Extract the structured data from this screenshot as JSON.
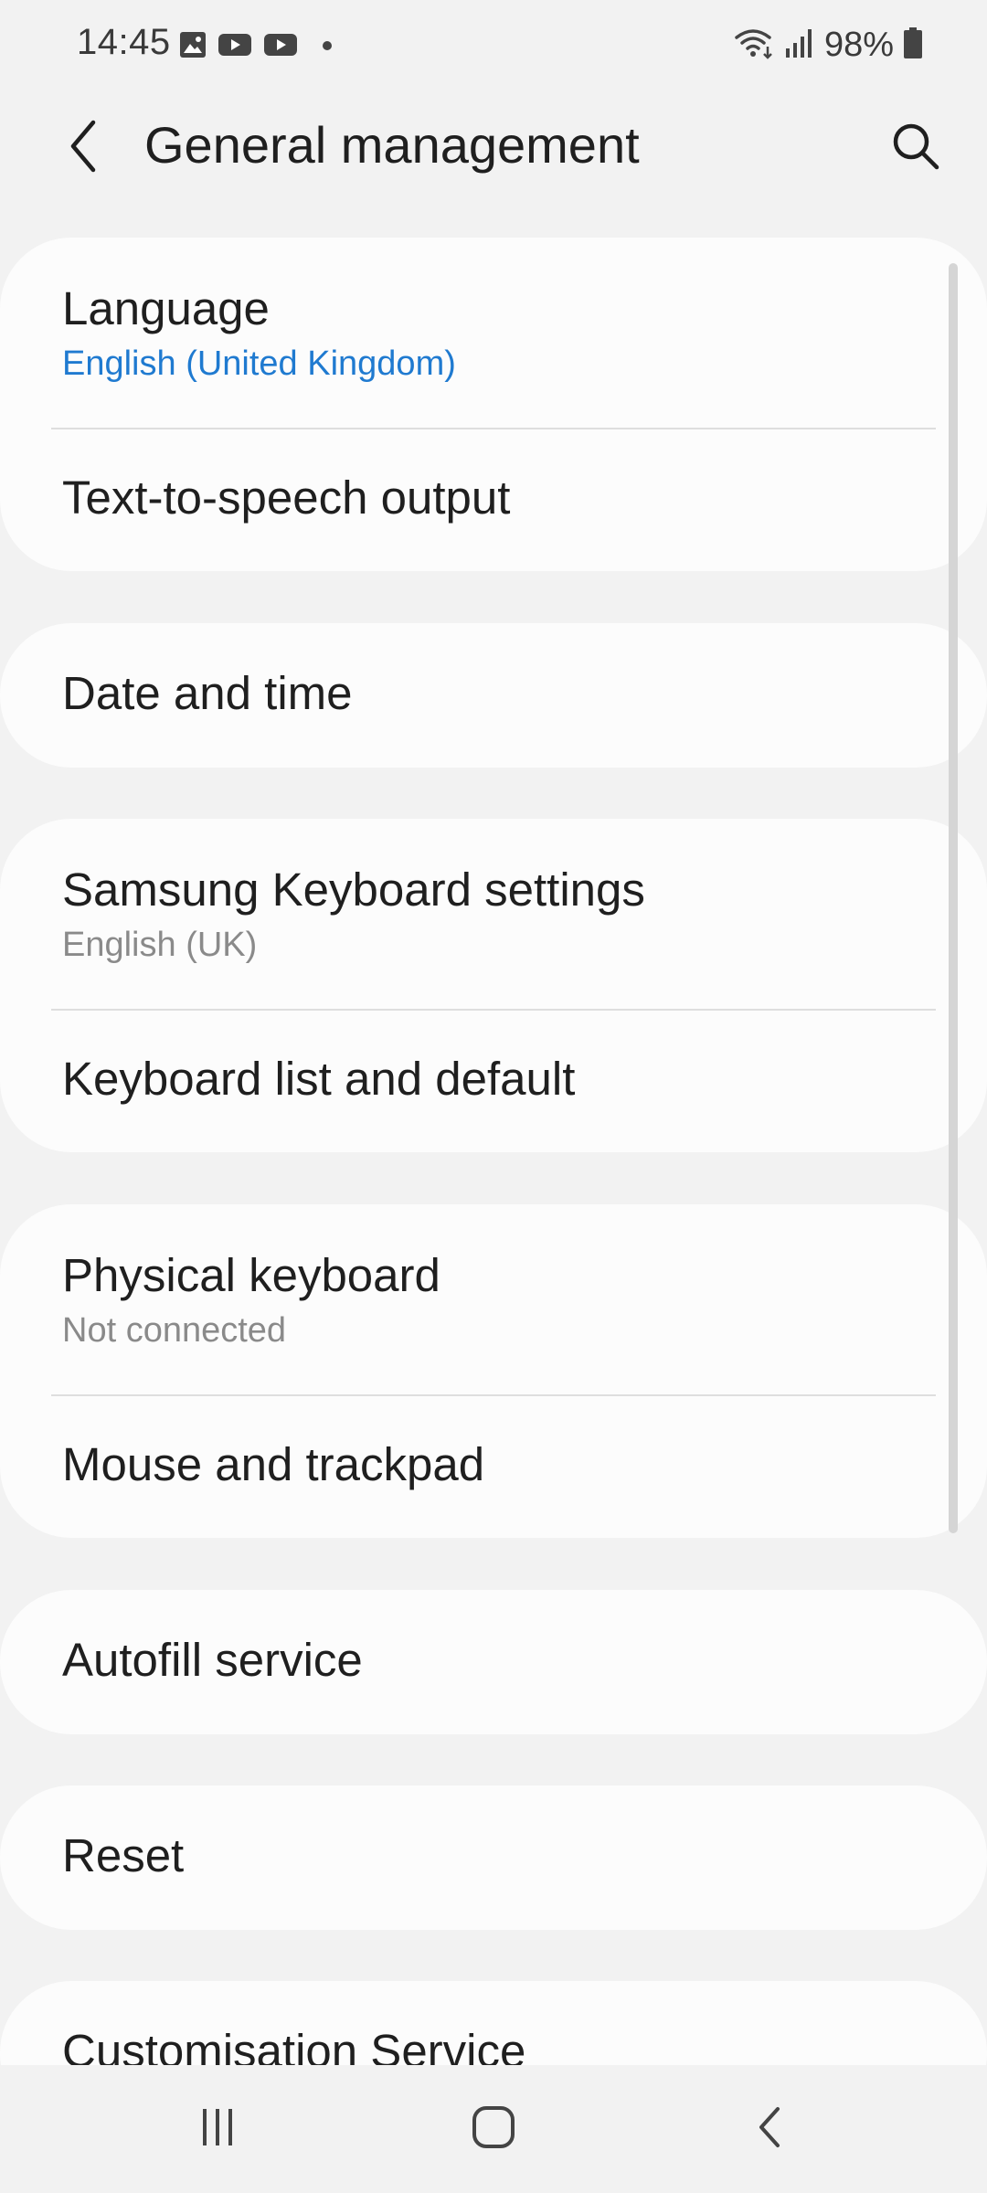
{
  "status_bar": {
    "time": "14:45",
    "battery": "98%",
    "icons": [
      "gallery-icon",
      "youtube-icon",
      "youtube-icon",
      "dot-icon",
      "wifi-icon",
      "signal-icon",
      "battery-icon"
    ]
  },
  "header": {
    "title": "General management",
    "back_icon": "chevron-left-icon",
    "search_icon": "search-icon"
  },
  "colors": {
    "background": "#f2f2f2",
    "card": "#fcfcfc",
    "accent": "#1f7ad0",
    "secondary_text": "#8a8a8a"
  },
  "items": {
    "language": {
      "title": "Language",
      "subtitle": "English (United Kingdom)"
    },
    "tts": {
      "title": "Text-to-speech output"
    },
    "date_time": {
      "title": "Date and time"
    },
    "samsung_keyboard": {
      "title": "Samsung Keyboard settings",
      "subtitle": "English (UK)"
    },
    "keyboard_list": {
      "title": "Keyboard list and default"
    },
    "physical_keyboard": {
      "title": "Physical keyboard",
      "subtitle": "Not connected"
    },
    "mouse_trackpad": {
      "title": "Mouse and trackpad"
    },
    "autofill": {
      "title": "Autofill service"
    },
    "reset": {
      "title": "Reset"
    },
    "customisation": {
      "title": "Customisation Service"
    }
  },
  "nav_bar": {
    "recents_icon": "recents-icon",
    "home_icon": "home-icon",
    "back_icon": "back-icon"
  }
}
